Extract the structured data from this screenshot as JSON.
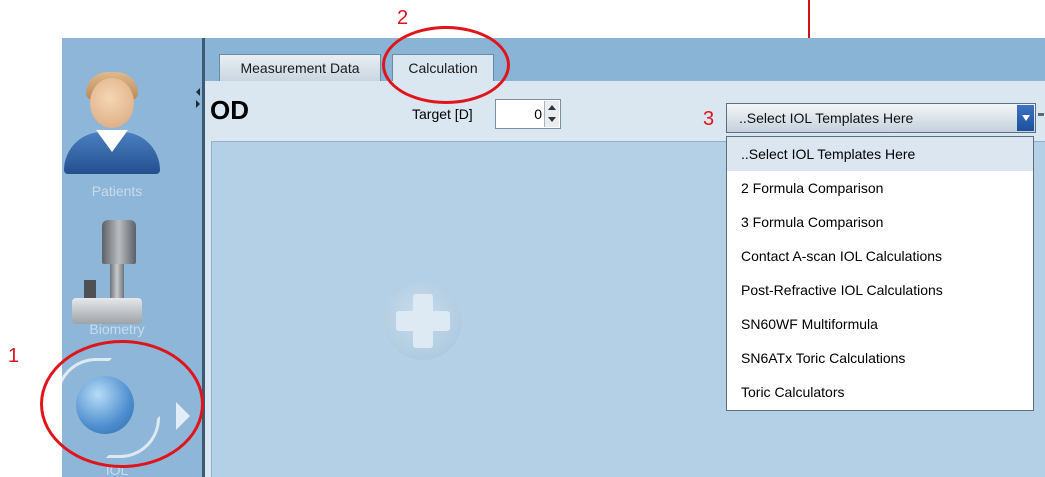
{
  "sidebar": {
    "items": [
      {
        "label": "Patients"
      },
      {
        "label": "Biometry"
      },
      {
        "label": "IOL"
      }
    ]
  },
  "tabs": [
    {
      "label": "Measurement Data"
    },
    {
      "label": "Calculation"
    }
  ],
  "panel": {
    "eye": "OD",
    "target_label": "Target [D]",
    "target_value": "0",
    "combo_value": "..Select IOL Templates Here"
  },
  "dropdown": {
    "options": [
      "..Select IOL Templates Here",
      "2 Formula Comparison",
      "3 Formula Comparison",
      "Contact A-scan IOL Calculations",
      "Post-Refractive IOL Calculations",
      "SN60WF Multiformula",
      "SN6ATx Toric Calculations",
      "Toric Calculators"
    ],
    "selected_index": 0
  },
  "annotations": {
    "step1": "1",
    "step2": "2",
    "step3": "3",
    "color": "#e0141b"
  }
}
